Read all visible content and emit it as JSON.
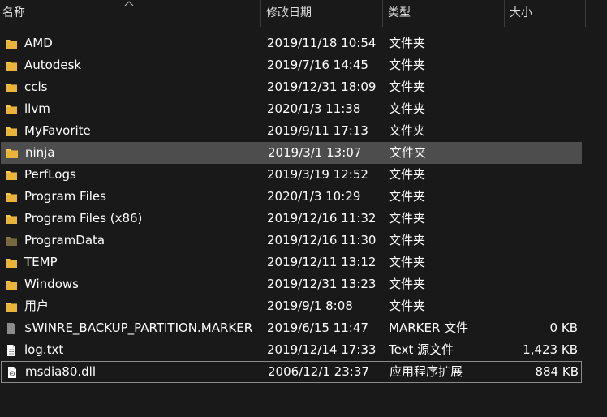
{
  "columns": {
    "name": "名称",
    "date": "修改日期",
    "type": "类型",
    "size": "大小"
  },
  "files": [
    {
      "name": "AMD",
      "date": "2019/11/18 10:54",
      "type": "文件夹",
      "size": "",
      "icon": "folder-icon"
    },
    {
      "name": "Autodesk",
      "date": "2019/7/16 14:45",
      "type": "文件夹",
      "size": "",
      "icon": "folder-icon"
    },
    {
      "name": "ccls",
      "date": "2019/12/31 18:09",
      "type": "文件夹",
      "size": "",
      "icon": "folder-icon"
    },
    {
      "name": "llvm",
      "date": "2020/1/3 11:38",
      "type": "文件夹",
      "size": "",
      "icon": "folder-icon"
    },
    {
      "name": "MyFavorite",
      "date": "2019/9/11 17:13",
      "type": "文件夹",
      "size": "",
      "icon": "folder-icon"
    },
    {
      "name": "ninja",
      "date": "2019/3/1 13:07",
      "type": "文件夹",
      "size": "",
      "icon": "folder-icon",
      "selected": true
    },
    {
      "name": "PerfLogs",
      "date": "2019/3/19 12:52",
      "type": "文件夹",
      "size": "",
      "icon": "folder-icon"
    },
    {
      "name": "Program Files",
      "date": "2020/1/3 10:29",
      "type": "文件夹",
      "size": "",
      "icon": "folder-icon"
    },
    {
      "name": "Program Files (x86)",
      "date": "2019/12/16 11:32",
      "type": "文件夹",
      "size": "",
      "icon": "folder-icon"
    },
    {
      "name": "ProgramData",
      "date": "2019/12/16 11:30",
      "type": "文件夹",
      "size": "",
      "icon": "hidden-folder-icon"
    },
    {
      "name": "TEMP",
      "date": "2019/12/11 13:12",
      "type": "文件夹",
      "size": "",
      "icon": "folder-icon"
    },
    {
      "name": "Windows",
      "date": "2019/12/31 13:23",
      "type": "文件夹",
      "size": "",
      "icon": "folder-icon"
    },
    {
      "name": "用户",
      "date": "2019/9/1 8:08",
      "type": "文件夹",
      "size": "",
      "icon": "folder-icon"
    },
    {
      "name": "$WINRE_BACKUP_PARTITION.MARKER",
      "date": "2019/6/15 11:47",
      "type": "MARKER 文件",
      "size": "0 KB",
      "icon": "hidden-file-icon"
    },
    {
      "name": "log.txt",
      "date": "2019/12/14 17:33",
      "type": "Text 源文件",
      "size": "1,423 KB",
      "icon": "text-file-icon"
    },
    {
      "name": "msdia80.dll",
      "date": "2006/12/1 23:37",
      "type": "应用程序扩展",
      "size": "884 KB",
      "icon": "dll-file-icon",
      "focused": true
    }
  ],
  "colors": {
    "background": "#191919",
    "folder": "#f8c94a",
    "hidden_folder": "#8a7a4a",
    "selection": "#4d4d4d"
  }
}
